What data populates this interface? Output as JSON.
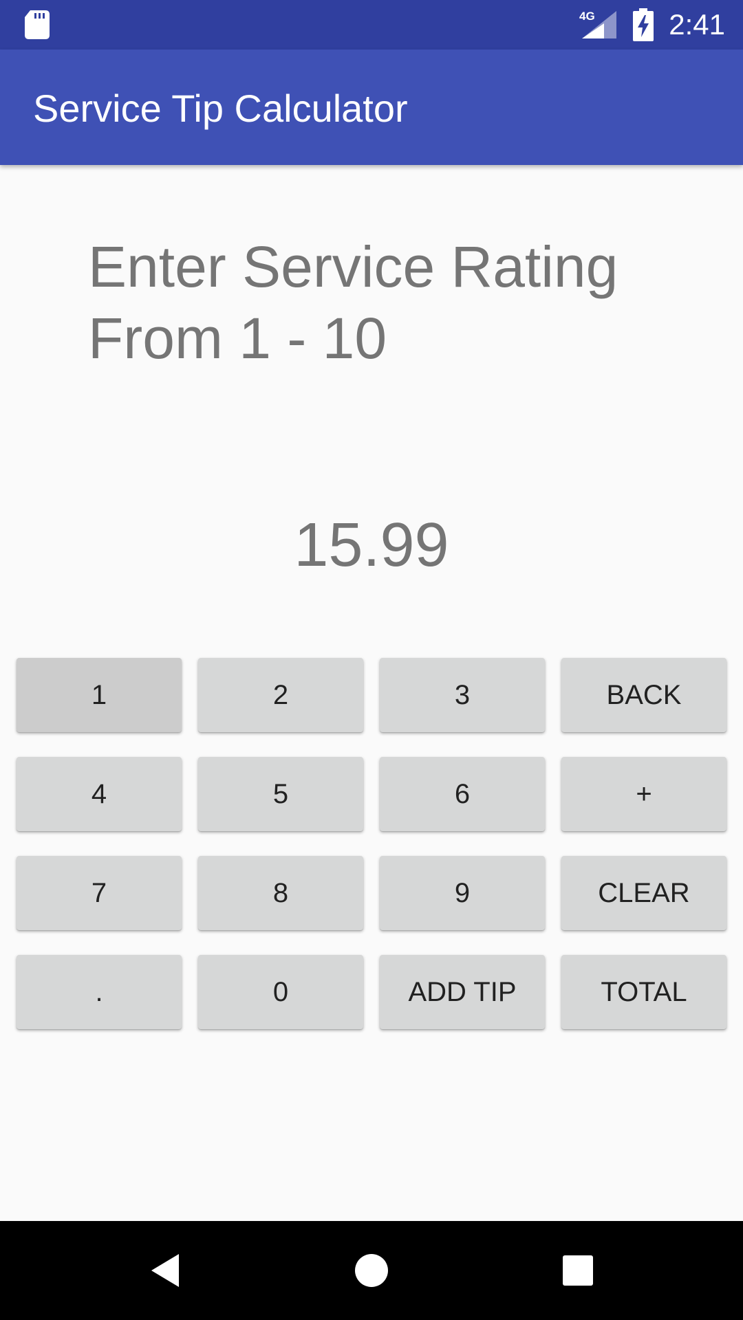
{
  "status_bar": {
    "time": "2:41",
    "network_label": "4G",
    "icons": [
      "sd-card-icon",
      "signal-icon",
      "battery-charging-icon"
    ]
  },
  "app_bar": {
    "title": "Service Tip Calculator",
    "color": "#3f51b5",
    "status_color": "#303f9f"
  },
  "prompt": {
    "line1": "Enter Service Rating",
    "line2": "From 1 - 10"
  },
  "display": {
    "value": "15.99"
  },
  "keypad": {
    "keys": [
      {
        "label": "1",
        "name": "key-1",
        "pressed": true
      },
      {
        "label": "2",
        "name": "key-2"
      },
      {
        "label": "3",
        "name": "key-3"
      },
      {
        "label": "BACK",
        "name": "back-button"
      },
      {
        "label": "4",
        "name": "key-4"
      },
      {
        "label": "5",
        "name": "key-5"
      },
      {
        "label": "6",
        "name": "key-6"
      },
      {
        "label": "+",
        "name": "plus-button"
      },
      {
        "label": "7",
        "name": "key-7"
      },
      {
        "label": "8",
        "name": "key-8"
      },
      {
        "label": "9",
        "name": "key-9"
      },
      {
        "label": "CLEAR",
        "name": "clear-button"
      },
      {
        "label": ".",
        "name": "decimal-button"
      },
      {
        "label": "0",
        "name": "key-0"
      },
      {
        "label": "ADD TIP",
        "name": "add-tip-button"
      },
      {
        "label": "TOTAL",
        "name": "total-button"
      }
    ]
  },
  "nav_bar": {
    "buttons": [
      "back-icon",
      "home-icon",
      "recents-icon"
    ]
  }
}
